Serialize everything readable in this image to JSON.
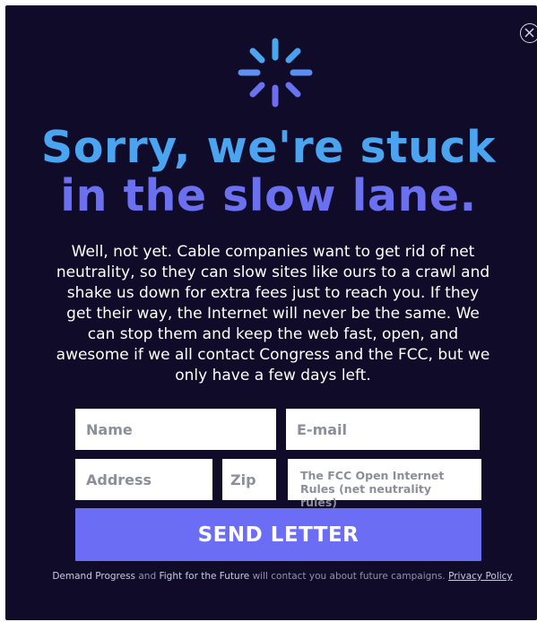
{
  "modal": {
    "headline_line1": "Sorry, we're stuck",
    "headline_line2": "in the slow lane.",
    "body": "Well, not yet. Cable companies want to get rid of net neutrality, so they can slow sites like ours to a crawl and shake us down for extra fees just to reach you. If they get their way, the Internet will never be the same. We can stop them and keep the web fast, open, and awesome if we all contact Congress and the FCC, but we only have a few days left.",
    "close_icon": "close-circle-icon",
    "spinner_icon": "loading-spinner-icon"
  },
  "form": {
    "name_placeholder": "Name",
    "email_placeholder": "E-mail",
    "address_placeholder": "Address",
    "zip_placeholder": "Zip",
    "subject_text": "The FCC Open Internet Rules (net neutrality rules)",
    "submit_label": "SEND LETTER"
  },
  "footer": {
    "org1": "Demand Progress",
    "and": "and",
    "org2": "Fight for the Future",
    "text": "will contact you about future  campaigns.",
    "privacy_label": "Privacy Policy"
  },
  "colors": {
    "background": "#100b29",
    "headline_blue": "#4ba4ef",
    "headline_purple": "#6b70f0",
    "button": "#6b6ef4"
  }
}
